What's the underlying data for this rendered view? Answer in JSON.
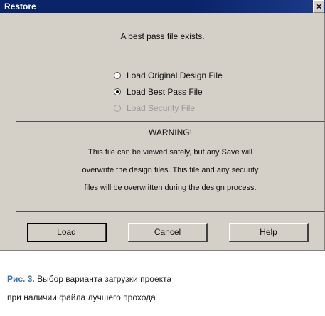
{
  "window": {
    "title": "Restore",
    "close_glyph": "×"
  },
  "message": "A best pass file exists.",
  "options": [
    {
      "label": "Load Original Design File",
      "checked": false,
      "disabled": false
    },
    {
      "label": "Load Best Pass File",
      "checked": true,
      "disabled": false
    },
    {
      "label": "Load Security File",
      "checked": false,
      "disabled": true
    }
  ],
  "warning": {
    "title": "WARNING!",
    "lines": [
      "This file can be viewed safely, but any Save will",
      "overwrite the design files. This file and any security",
      "files will be overwritten during the design process."
    ]
  },
  "buttons": {
    "load": "Load",
    "cancel": "Cancel",
    "help": "Help"
  },
  "caption": {
    "label": "Рис. 3.",
    "line1": " Выбор варианта загрузки проекта",
    "line2": "при наличии файла лучшего прохода"
  }
}
